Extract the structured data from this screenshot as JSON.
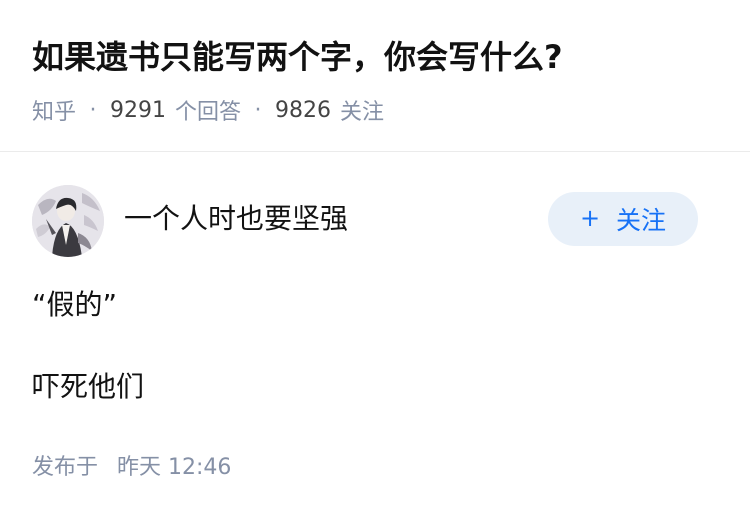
{
  "question": {
    "title": "如果遗书只能写两个字，你会写什么?",
    "source": "知乎",
    "answer_count": "9291",
    "answer_label": "个回答",
    "follower_count": "9826",
    "follower_label": "关注",
    "separator": "·"
  },
  "answer": {
    "author_name": "一个人时也要坚强",
    "avatar_icon": "avatar-portrait",
    "follow_label": "关注",
    "follow_plus": "+",
    "paragraphs": [
      "“假的”",
      "吓死他们"
    ],
    "time_prefix": "发布于",
    "time_value": "昨天 12:46"
  },
  "colors": {
    "title": "#121212",
    "meta": "#8590a6",
    "follow_bg": "#e8f0f9",
    "follow_text": "#1772f6",
    "divider": "#ebebeb"
  }
}
